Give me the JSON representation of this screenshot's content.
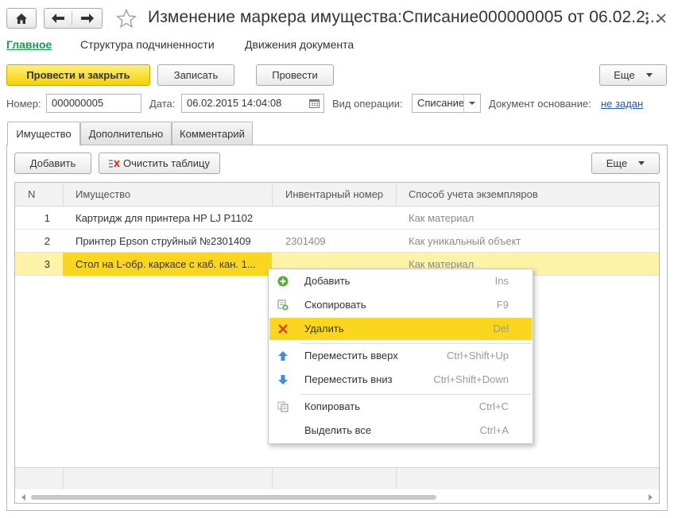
{
  "header": {
    "title": "Изменение маркера имущества:Списание000000005 от 06.02.2...",
    "more_icon": "more-vertical-icon",
    "close_icon": "close-icon"
  },
  "sections": [
    {
      "label": "Главное",
      "active": true
    },
    {
      "label": "Структура подчиненности"
    },
    {
      "label": "Движения документа"
    }
  ],
  "toolbar": {
    "post_close": "Провести и закрыть",
    "save": "Записать",
    "post": "Провести",
    "more": "Еще"
  },
  "fields": {
    "number_label": "Номер:",
    "number_value": "000000005",
    "date_label": "Дата:",
    "date_value": "06.02.2015 14:04:08",
    "op_label": "Вид операции:",
    "op_value": "Списание",
    "basis_label": "Документ основание:",
    "basis_value": "не задан"
  },
  "tabs": [
    {
      "label": "Имущество",
      "active": true
    },
    {
      "label": "Дополнительно"
    },
    {
      "label": "Комментарий"
    }
  ],
  "table_toolbar": {
    "add": "Добавить",
    "clear": "Очистить таблицу",
    "more": "Еще"
  },
  "table": {
    "columns": [
      "N",
      "Имущество",
      "Инвентарный номер",
      "Способ учета экземпляров"
    ],
    "rows": [
      {
        "n": "1",
        "item": "Картридж для принтера HP LJ P1102",
        "inv": "",
        "method": "Как материал"
      },
      {
        "n": "2",
        "item": "Принтер Epson струйный №2301409",
        "inv": "2301409",
        "method": "Как уникальный объект"
      },
      {
        "n": "3",
        "item": "Стол на L-обр. каркасе с каб. кан. 1...",
        "inv": "",
        "method": "Как материал"
      }
    ]
  },
  "context_menu": {
    "items": [
      {
        "label": "Добавить",
        "shortcut": "Ins",
        "icon": "add-icon"
      },
      {
        "label": "Скопировать",
        "shortcut": "F9",
        "icon": "copy-row-icon"
      },
      {
        "label": "Удалить",
        "shortcut": "Del",
        "icon": "delete-icon",
        "highlighted": true
      },
      {
        "label": "Переместить вверх",
        "shortcut": "Ctrl+Shift+Up",
        "icon": "arrow-up-icon"
      },
      {
        "label": "Переместить вниз",
        "shortcut": "Ctrl+Shift+Down",
        "icon": "arrow-down-icon"
      },
      {
        "label": "Копировать",
        "shortcut": "Ctrl+C",
        "icon": "copy-icon"
      },
      {
        "label": "Выделить все",
        "shortcut": "Ctrl+A",
        "icon": ""
      }
    ]
  },
  "colors": {
    "accent_yellow": "#fad61e",
    "selected_row": "#fdf3a7",
    "active_section": "#1d9a5a",
    "link": "#1e58b4"
  }
}
